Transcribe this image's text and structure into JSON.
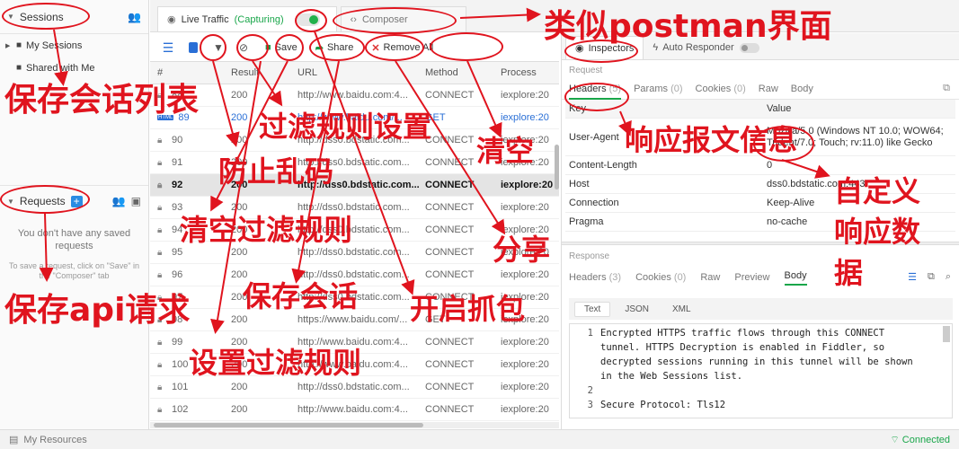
{
  "sidebar": {
    "sessions_title": "Sessions",
    "items": [
      {
        "label": "My Sessions"
      },
      {
        "label": "Shared with Me"
      }
    ],
    "requests_title": "Requests",
    "empty_title": "You don't have any saved requests",
    "empty_hint": "To save a request, click on \"Save\" in the \"Composer\" tab"
  },
  "tabs": {
    "live_traffic": "Live Traffic",
    "capturing": "(Capturing)",
    "composer": "Composer"
  },
  "toolbar": {
    "save": "Save",
    "share": "Share",
    "remove_all": "Remove All"
  },
  "grid": {
    "columns": [
      "#",
      "Result",
      "URL",
      "Method",
      "Process"
    ],
    "rows": [
      {
        "num": "88",
        "result": "200",
        "url": "http://www.baidu.com:4...",
        "method": "CONNECT",
        "process": "iexplore:20"
      },
      {
        "num": "89",
        "result": "200",
        "url": "http://www.baidu.com/...",
        "method": "GET",
        "process": "iexplore:20"
      },
      {
        "num": "90",
        "result": "200",
        "url": "http://dss0.bdstatic.com...",
        "method": "CONNECT",
        "process": "iexplore:20"
      },
      {
        "num": "91",
        "result": "200",
        "url": "http://dss0.bdstatic.com...",
        "method": "CONNECT",
        "process": "iexplore:20"
      },
      {
        "num": "92",
        "result": "200",
        "url": "http://dss0.bdstatic.com...",
        "method": "CONNECT",
        "process": "iexplore:20"
      },
      {
        "num": "93",
        "result": "200",
        "url": "http://dss0.bdstatic.com...",
        "method": "CONNECT",
        "process": "iexplore:20"
      },
      {
        "num": "94",
        "result": "200",
        "url": "http://dss0.bdstatic.com...",
        "method": "CONNECT",
        "process": "iexplore:20"
      },
      {
        "num": "95",
        "result": "200",
        "url": "http://dss0.bdstatic.com...",
        "method": "CONNECT",
        "process": "iexplore:20"
      },
      {
        "num": "96",
        "result": "200",
        "url": "http://dss0.bdstatic.com...",
        "method": "CONNECT",
        "process": "iexplore:20"
      },
      {
        "num": "97",
        "result": "200",
        "url": "http://dss0.bdstatic.com...",
        "method": "CONNECT",
        "process": "iexplore:20"
      },
      {
        "num": "98",
        "result": "200",
        "url": "https://www.baidu.com/...",
        "method": "GET",
        "process": "iexplore:20"
      },
      {
        "num": "99",
        "result": "200",
        "url": "http://www.baidu.com:4...",
        "method": "CONNECT",
        "process": "iexplore:20"
      },
      {
        "num": "100",
        "result": "200",
        "url": "http://www.baidu.com:4...",
        "method": "CONNECT",
        "process": "iexplore:20"
      },
      {
        "num": "101",
        "result": "200",
        "url": "http://dss0.bdstatic.com...",
        "method": "CONNECT",
        "process": "iexplore:20"
      },
      {
        "num": "102",
        "result": "200",
        "url": "http://www.baidu.com:4...",
        "method": "CONNECT",
        "process": "iexplore:20"
      }
    ]
  },
  "inspectors": {
    "tab_inspectors": "Inspectors",
    "tab_auto_responder": "Auto Responder",
    "request_label": "Request",
    "request_tabs": [
      {
        "label": "Headers",
        "count": "(5)"
      },
      {
        "label": "Params",
        "count": "(0)"
      },
      {
        "label": "Cookies",
        "count": "(0)"
      },
      {
        "label": "Raw",
        "count": ""
      },
      {
        "label": "Body",
        "count": ""
      }
    ],
    "kv_header": {
      "key": "Key",
      "value": "Value"
    },
    "headers": [
      {
        "key": "User-Agent",
        "value": "Mozilla/5.0 (Windows NT 10.0; WOW64; Trident/7.0; Touch; rv:11.0) like Gecko"
      },
      {
        "key": "Content-Length",
        "value": "0"
      },
      {
        "key": "Host",
        "value": "dss0.bdstatic.com:443"
      },
      {
        "key": "Connection",
        "value": "Keep-Alive"
      },
      {
        "key": "Pragma",
        "value": "no-cache"
      }
    ],
    "response_label": "Response",
    "response_tabs": [
      {
        "label": "Headers",
        "count": "(3)"
      },
      {
        "label": "Cookies",
        "count": "(0)"
      },
      {
        "label": "Raw",
        "count": ""
      },
      {
        "label": "Preview",
        "count": ""
      },
      {
        "label": "Body",
        "count": ""
      }
    ],
    "formats": [
      "Text",
      "JSON",
      "XML"
    ],
    "body_lines": [
      {
        "n": "1",
        "text": "Encrypted HTTPS traffic flows through this CONNECT"
      },
      {
        "n": "",
        "text": "tunnel. HTTPS Decryption is enabled in Fiddler, so"
      },
      {
        "n": "",
        "text": "decrypted sessions running in this tunnel will be shown"
      },
      {
        "n": "",
        "text": "in the Web Sessions list."
      },
      {
        "n": "2",
        "text": ""
      },
      {
        "n": "3",
        "text": "Secure Protocol: Tls12"
      }
    ]
  },
  "status": {
    "my_resources": "My Resources",
    "connected": "Connected"
  },
  "annotations": {
    "postman_like": "类似postman界面",
    "save_session_list": "保存会话列表",
    "filter_settings": "过滤规则设置",
    "clear": "清空",
    "response_info": "响应报文信息",
    "prevent_garbled": "防止乱码",
    "clear_filter": "清空过滤规则",
    "custom_response_1": "自定义",
    "custom_response_2": "响应数",
    "custom_response_3": "据",
    "share": "分享",
    "save_api_request": "保存api请求",
    "save_session": "保存会话",
    "start_capture": "开启抓包",
    "set_filter": "设置过滤规则"
  }
}
